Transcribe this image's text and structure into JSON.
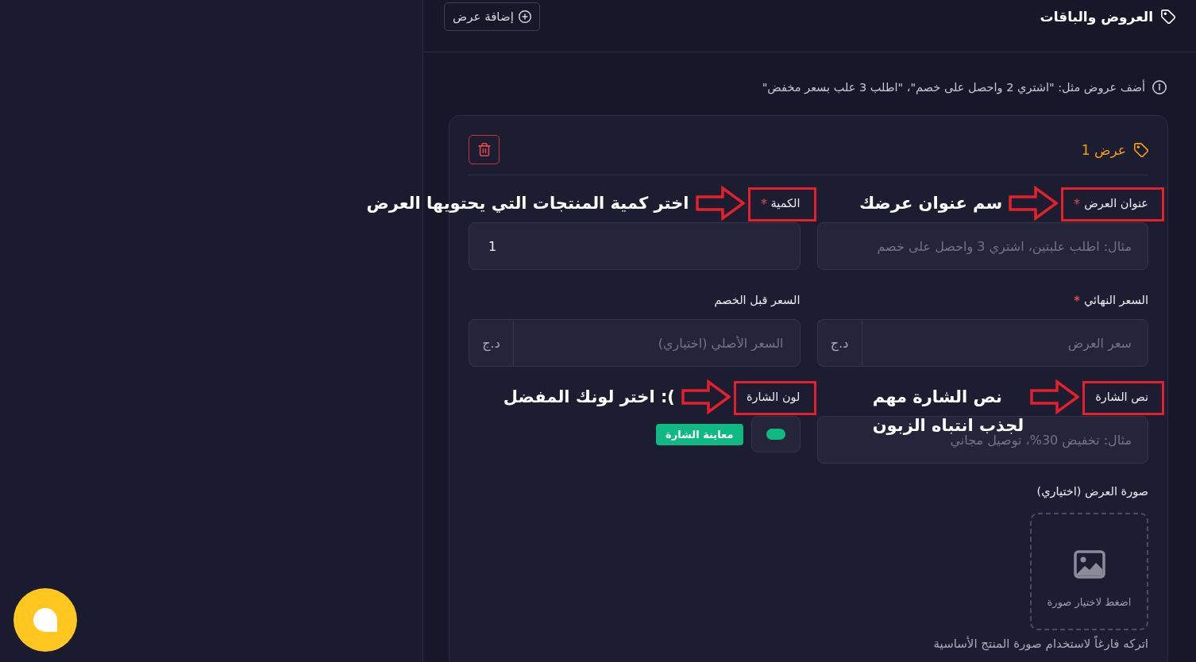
{
  "header": {
    "title": "العروض والباقات",
    "add_button": "إضافة عرض"
  },
  "info": "أضف عروض مثل: \"اشتري 2 واحصل على خصم\"، \"اطلب 3 علب بسعر مخفض\"",
  "offers": [
    {
      "title": "عرض 1",
      "fields": [
        {
          "kind": "text",
          "label": "عنوان العرض",
          "required": true,
          "placeholder": "مثال: اطلب علبتين، اشتري 3 واحصل على خصم",
          "annotation": "سم عنوان عرضك"
        },
        {
          "kind": "number",
          "label": "الكمية",
          "required": true,
          "value": "1",
          "annotation": "اختر كمية المنتجات التي يحتويها العرض"
        },
        {
          "kind": "price",
          "label": "السعر النهائي",
          "required": true,
          "placeholder": "سعر العرض",
          "currency": "د.ج"
        },
        {
          "kind": "price",
          "label": "السعر قبل الخصم",
          "required": false,
          "placeholder": "السعر الأصلي (اختياري)",
          "currency": "د.ج"
        },
        {
          "kind": "text",
          "label": "نص الشارة",
          "required": false,
          "placeholder": "مثال: تخفيض 30%، توصيل مجاني",
          "annotation": "نص الشارة مهم\nلجذب انتباه الزبون"
        },
        {
          "kind": "color",
          "label": "لون الشارة",
          "required": false,
          "color": "#10b981",
          "preview": "معاينة الشارة",
          "annotation": "اختر لونك المفضل :("
        }
      ],
      "image": {
        "label": "صورة العرض (اختياري)",
        "prompt": "اضغط لاختيار صورة",
        "hint": "اتركه فارغاً لاستخدام صورة المنتج الأساسية"
      }
    }
  ]
}
